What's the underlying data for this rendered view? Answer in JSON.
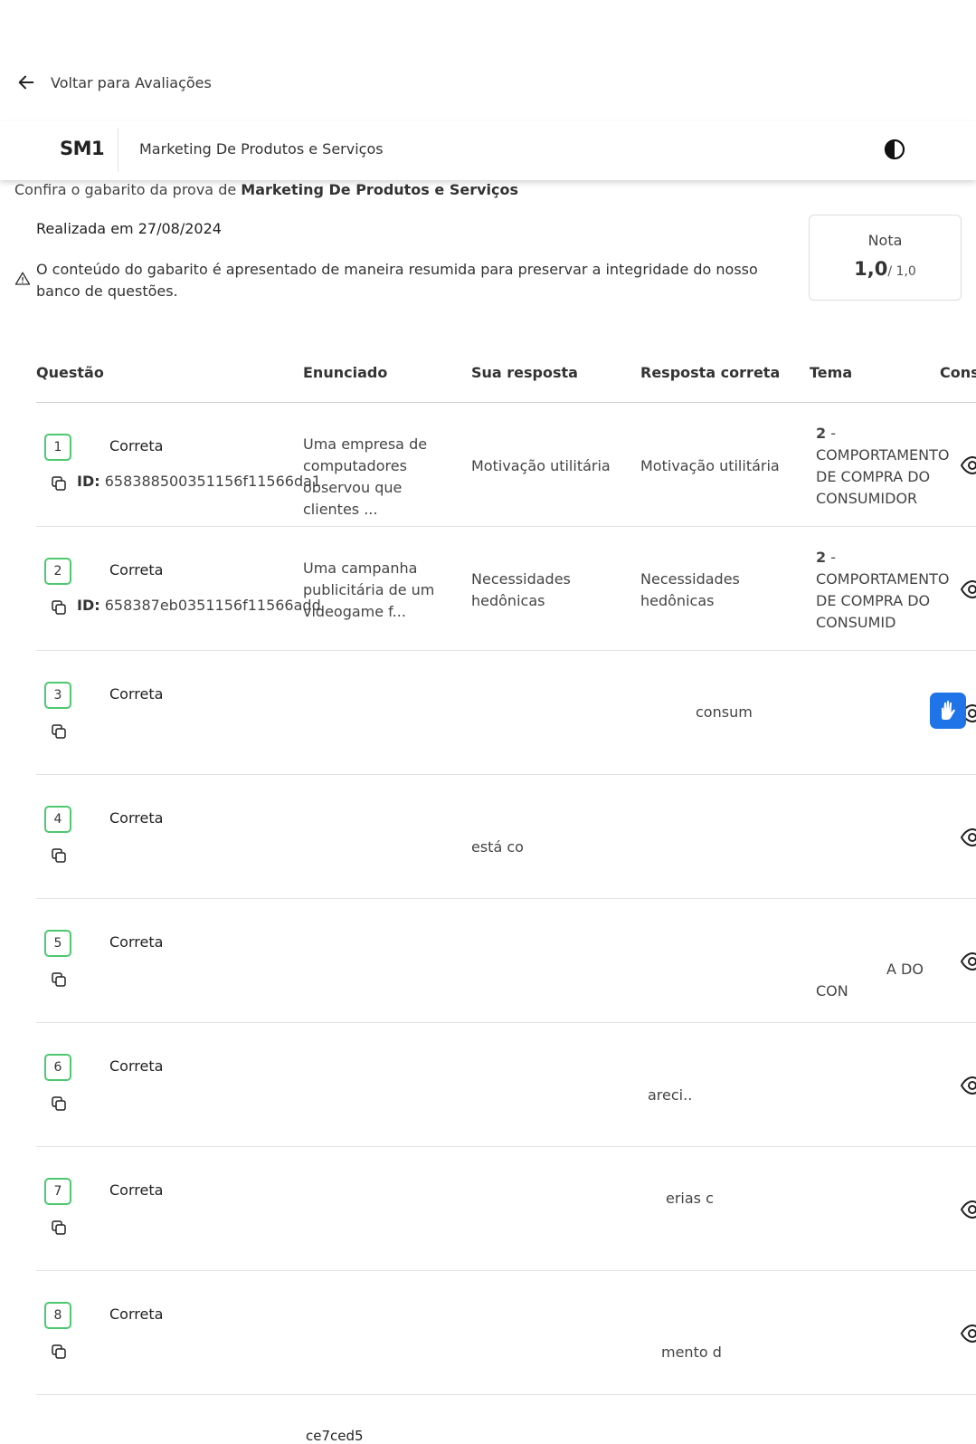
{
  "nav": {
    "back_label": "Voltar para Avaliações"
  },
  "header": {
    "brand": "SM1",
    "course": "Marketing De Produtos e Serviços"
  },
  "intro": {
    "prefix": "Confira o gabarito da prova de ",
    "course_bold": "Marketing De Produtos e Serviços"
  },
  "exam": {
    "date_text": "Realizada em 27/08/2024",
    "warning": "O conteúdo do gabarito é apresentado de maneira resumida para preservar a integridade do nosso banco de questões."
  },
  "grade": {
    "label": "Nota",
    "value": "1,0",
    "max": "/ 1,0"
  },
  "table": {
    "columns": [
      "Questão",
      "Enunciado",
      "Sua resposta",
      "Resposta correta",
      "Tema",
      "Cons"
    ],
    "rows": [
      {
        "number": "1",
        "status": "Correta",
        "id_label": "ID:",
        "id": "658388500351156f11566da1",
        "statement": "Uma empresa de computadores observou que clientes ...",
        "your_answer": "Motivação utilitária",
        "correct_answer": "Motivação utilitária",
        "theme_num": "2",
        "theme_text": " - COMPORTAMENTO DE COMPRA DO CONSUMIDOR"
      },
      {
        "number": "2",
        "status": "Correta",
        "id_label": "ID:",
        "id": "658387eb0351156f11566add",
        "statement": "Uma campanha publicitária de um videogame f...",
        "your_answer": "Necessidades hedônicas",
        "correct_answer": "Necessidades hedônicas",
        "theme_num": "2",
        "theme_text": " - COMPORTAMENTO DE COMPRA DO CONSUMID"
      },
      {
        "number": "3",
        "status": "Correta",
        "fragment": "consum"
      },
      {
        "number": "4",
        "status": "Correta",
        "fragment": "está co"
      },
      {
        "number": "5",
        "status": "Correta",
        "fragment_a": "A DO",
        "fragment_b": "CON"
      },
      {
        "number": "6",
        "status": "Correta",
        "fragment": "areci.."
      },
      {
        "number": "7",
        "status": "Correta",
        "fragment": "erias c"
      },
      {
        "number": "8",
        "status": "Correta",
        "fragment": "mento d"
      }
    ]
  },
  "footer_fragment": "ce7ced5",
  "icons": [
    "arrow-left-icon",
    "contrast-icon",
    "warning-icon",
    "copy-icon",
    "eye-icon",
    "sign-language-icon"
  ],
  "colors": {
    "badge_border": "#4cc96f",
    "vlibras": "#1f74e8"
  }
}
